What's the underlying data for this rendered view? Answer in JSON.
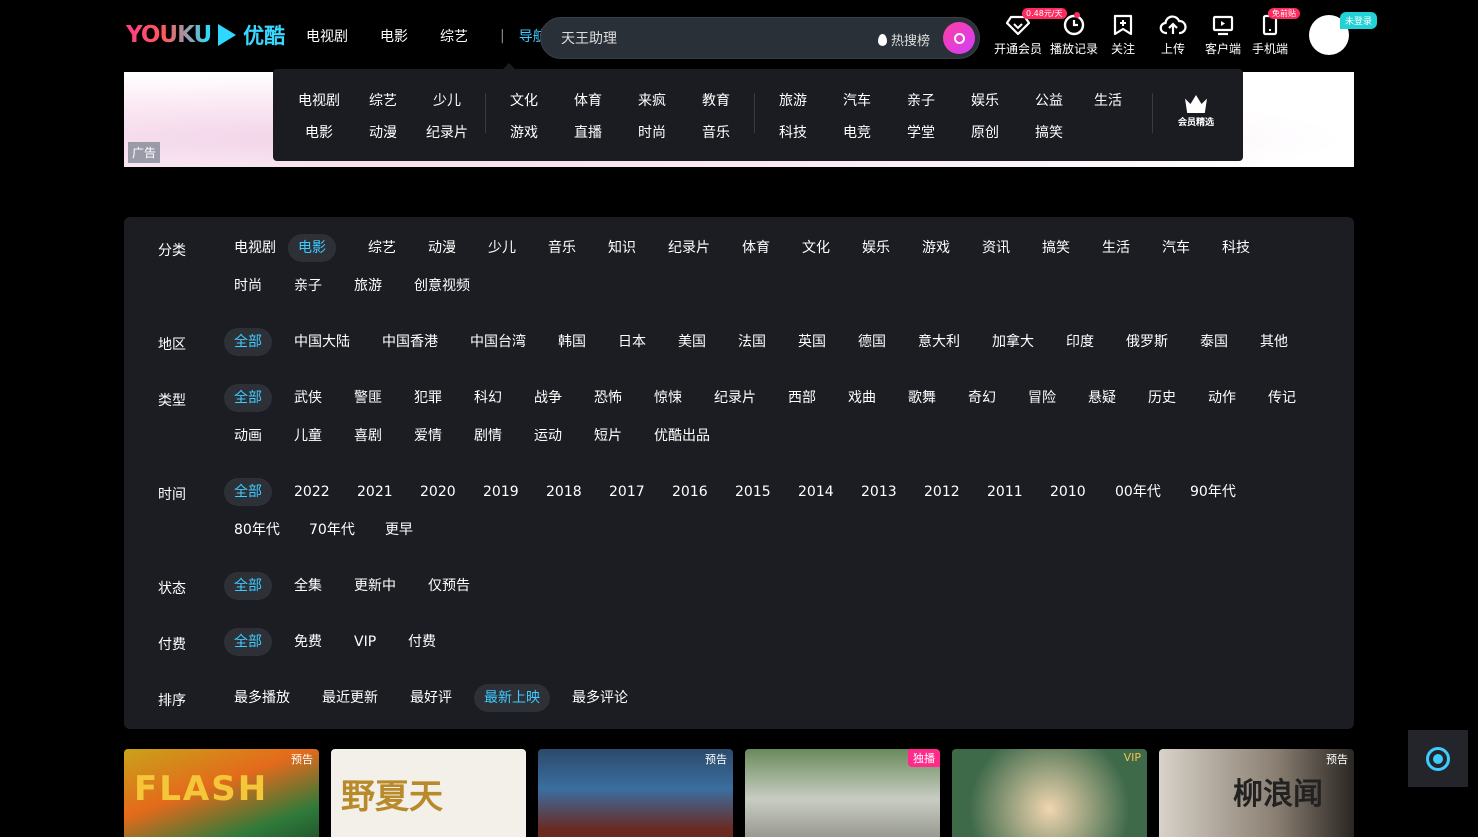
{
  "header": {
    "logo_en": "YOUKU",
    "logo_cn": "优酷",
    "nav": [
      "电视剧",
      "电影",
      "综艺"
    ],
    "separator": "|",
    "guide_label": "导航",
    "search_value": "天王助理",
    "hot_label": "热搜榜",
    "tools": [
      {
        "label": "开通会员",
        "icon": "diamond-icon",
        "badge": "0.48元/天"
      },
      {
        "label": "播放记录",
        "icon": "clock-icon"
      },
      {
        "label": "关注",
        "icon": "bookmark-plus-icon"
      },
      {
        "label": "上传",
        "icon": "upload-cloud-icon"
      },
      {
        "label": "客户端",
        "icon": "tv-icon"
      },
      {
        "label": "手机端",
        "icon": "phone-icon",
        "badge": "免前贴"
      }
    ],
    "login_tag": "未登录"
  },
  "banner": {
    "ad_tag": "广告"
  },
  "dropnav": {
    "group1": [
      [
        "电视剧",
        "电影"
      ],
      [
        "综艺",
        "动漫"
      ],
      [
        "少儿",
        "纪录片"
      ]
    ],
    "group2": [
      [
        "文化",
        "游戏"
      ],
      [
        "体育",
        "直播"
      ],
      [
        "来疯",
        "时尚"
      ],
      [
        "教育",
        "音乐"
      ]
    ],
    "group3": [
      [
        "旅游",
        "科技"
      ],
      [
        "汽车",
        "电竞"
      ],
      [
        "亲子",
        "学堂"
      ],
      [
        "娱乐",
        "原创"
      ],
      [
        "公益",
        "搞笑"
      ],
      [
        "生活",
        ""
      ]
    ],
    "vip_pick": "会员精选"
  },
  "filter": {
    "category": {
      "label": "分类",
      "options": [
        "电视剧",
        "电影",
        "综艺",
        "动漫",
        "少儿",
        "音乐",
        "知识",
        "纪录片",
        "体育",
        "文化",
        "娱乐",
        "游戏",
        "资讯",
        "搞笑",
        "生活",
        "汽车",
        "科技",
        "时尚",
        "亲子",
        "旅游",
        "创意视频"
      ]
    },
    "region": {
      "label": "地区",
      "options": [
        "全部",
        "中国大陆",
        "中国香港",
        "中国台湾",
        "韩国",
        "日本",
        "美国",
        "法国",
        "英国",
        "德国",
        "意大利",
        "加拿大",
        "印度",
        "俄罗斯",
        "泰国",
        "其他"
      ]
    },
    "genre": {
      "label": "类型",
      "options": [
        "全部",
        "武侠",
        "警匪",
        "犯罪",
        "科幻",
        "战争",
        "恐怖",
        "惊悚",
        "纪录片",
        "西部",
        "戏曲",
        "歌舞",
        "奇幻",
        "冒险",
        "悬疑",
        "历史",
        "动作",
        "传记",
        "动画",
        "儿童",
        "喜剧",
        "爱情",
        "剧情",
        "运动",
        "短片",
        "优酷出品"
      ]
    },
    "time": {
      "label": "时间",
      "options": [
        "全部",
        "2022",
        "2021",
        "2020",
        "2019",
        "2018",
        "2017",
        "2016",
        "2015",
        "2014",
        "2013",
        "2012",
        "2011",
        "2010",
        "00年代",
        "90年代",
        "80年代",
        "70年代",
        "更早"
      ]
    },
    "status": {
      "label": "状态",
      "options": [
        "全部",
        "全集",
        "更新中",
        "仅预告"
      ]
    },
    "pay": {
      "label": "付费",
      "options": [
        "全部",
        "免费",
        "VIP",
        "付费"
      ]
    },
    "sort": {
      "label": "排序",
      "options": [
        "最多播放",
        "最近更新",
        "最好评",
        "最新上映",
        "最多评论"
      ]
    },
    "selected": {
      "category": "电影",
      "region": "全部",
      "genre": "全部",
      "time": "全部",
      "status": "全部",
      "pay": "全部",
      "sort": "最新上映"
    }
  },
  "posters": [
    {
      "tag": "预告",
      "title": "FLASH"
    },
    {
      "tag": "",
      "title": "野夏天"
    },
    {
      "tag": "预告",
      "title": ""
    },
    {
      "tag": "独播",
      "title": ""
    },
    {
      "tag": "VIP",
      "title": ""
    },
    {
      "tag": "预告",
      "title": "柳浪闻"
    }
  ],
  "colors": {
    "accent": "#3ecbff",
    "panel": "#1c1d23",
    "pink": "#ff2a8a"
  }
}
